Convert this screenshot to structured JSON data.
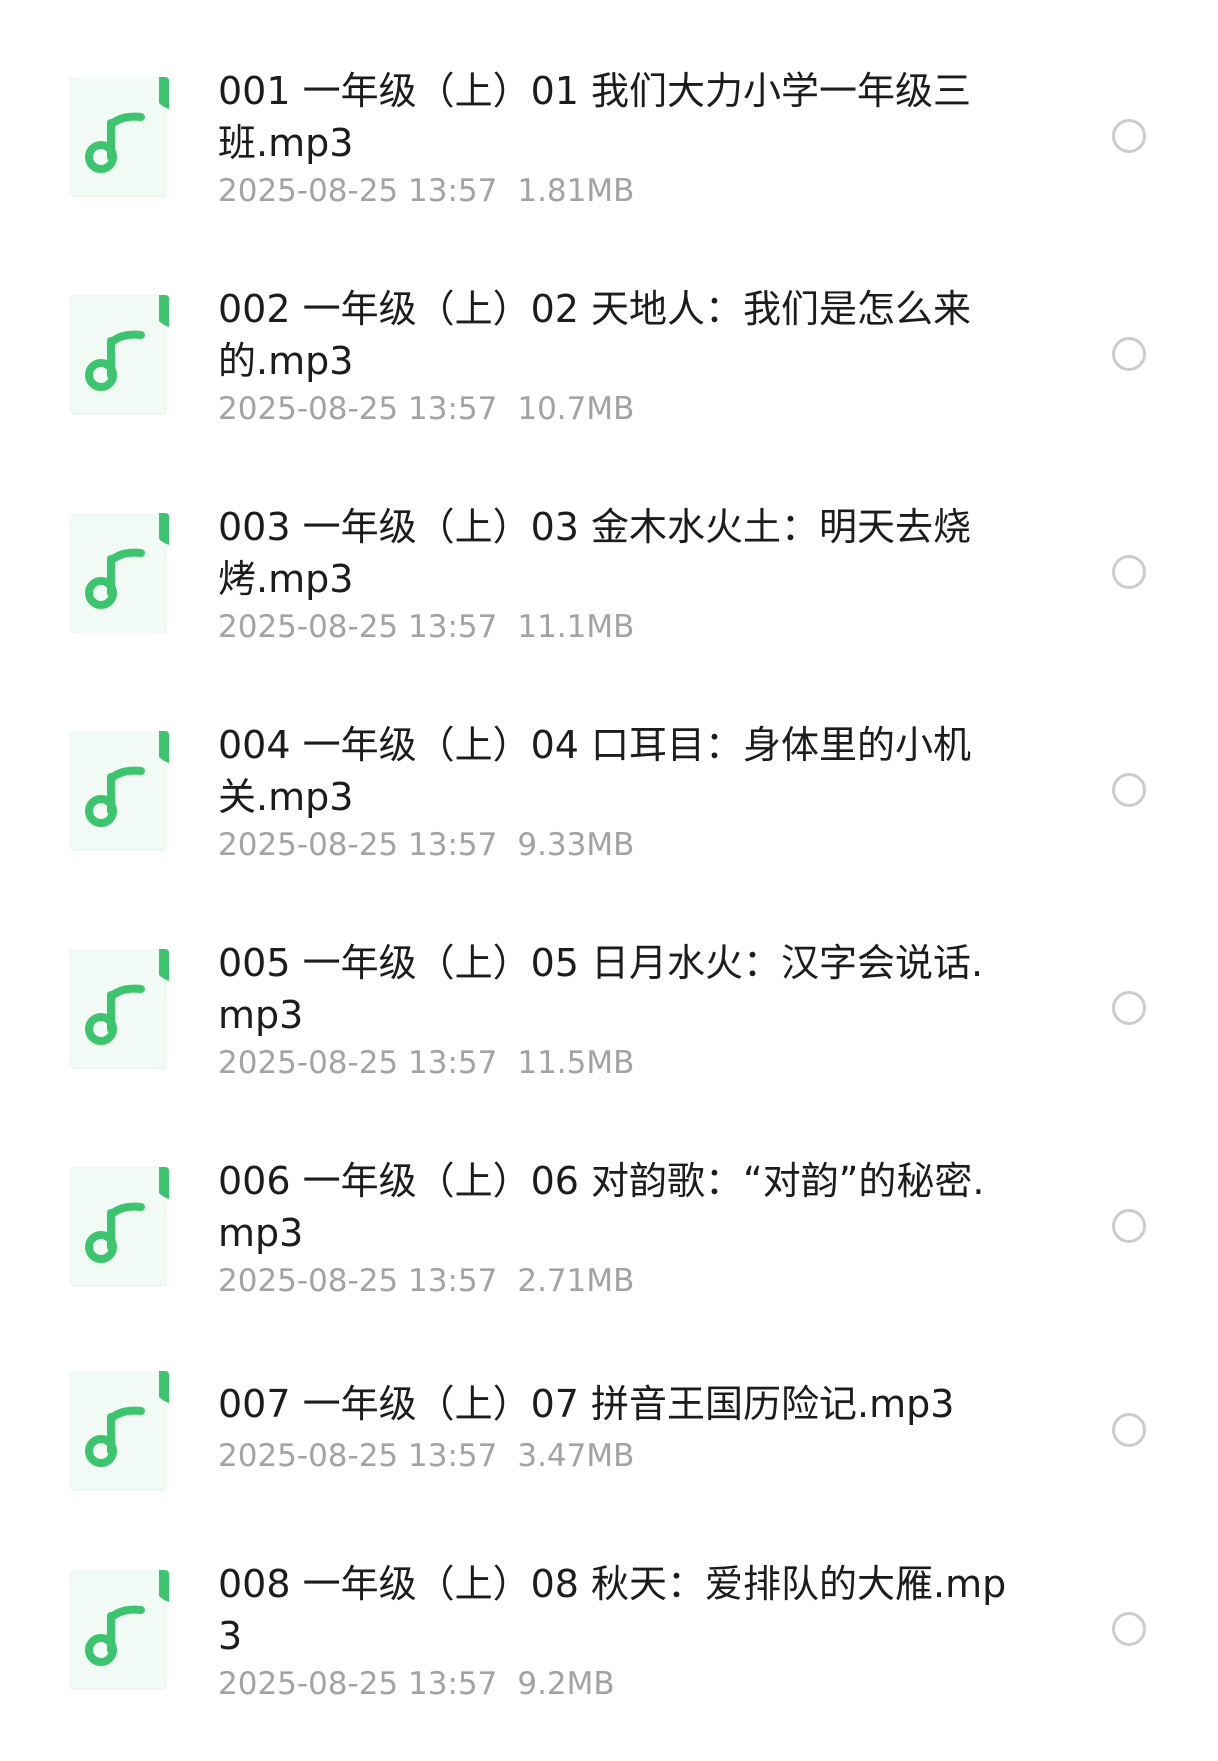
{
  "colors": {
    "icon_green": "#3cc46e",
    "icon_paper": "#eef8f1",
    "meta_gray": "#a3a3a3",
    "radio_gray": "#cccccc"
  },
  "icon": "music-note-file-icon",
  "files": [
    {
      "name": "001 一年级（上）01 我们大力小学一年级三班.mp3",
      "date": "2025-08-25 13:57",
      "size": "1.81MB"
    },
    {
      "name": "002 一年级（上）02 天地人：我们是怎么来的.mp3",
      "date": "2025-08-25 13:57",
      "size": "10.7MB"
    },
    {
      "name": "003 一年级（上）03 金木水火土：明天去烧烤.mp3",
      "date": "2025-08-25 13:57",
      "size": "11.1MB"
    },
    {
      "name": "004 一年级（上）04 口耳目：身体里的小机关.mp3",
      "date": "2025-08-25 13:57",
      "size": "9.33MB"
    },
    {
      "name": "005 一年级（上）05 日月水火：汉字会说话.mp3",
      "date": "2025-08-25 13:57",
      "size": "11.5MB"
    },
    {
      "name": "006 一年级（上）06 对韵歌：“对韵”的秘密.mp3",
      "date": "2025-08-25 13:57",
      "size": "2.71MB"
    },
    {
      "name": "007 一年级（上）07 拼音王国历险记.mp3",
      "date": "2025-08-25 13:57",
      "size": "3.47MB"
    },
    {
      "name": "008 一年级（上）08 秋天：爱排队的大雁.mp3",
      "date": "2025-08-25 13:57",
      "size": "9.2MB"
    }
  ]
}
